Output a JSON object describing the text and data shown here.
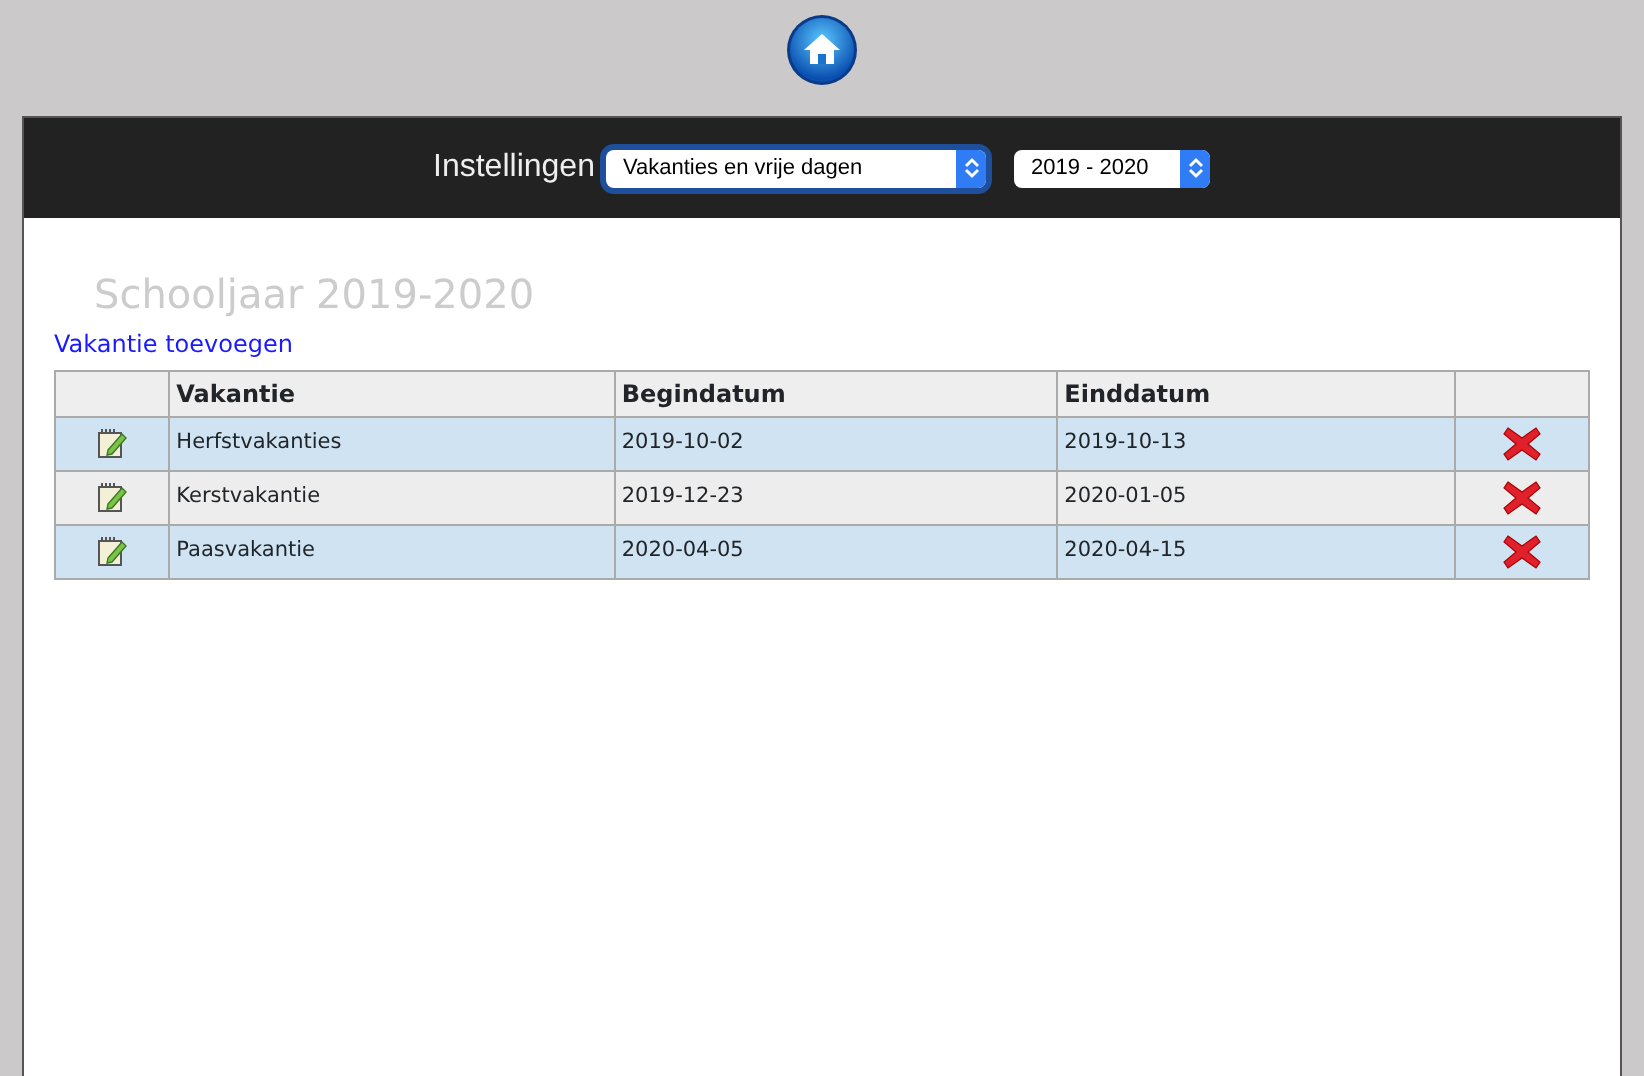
{
  "header": {
    "label": "Instellingen",
    "selects": [
      {
        "value": "Vakanties en vrije dagen",
        "focused": true
      },
      {
        "value": "2019 - 2020",
        "focused": false
      }
    ]
  },
  "title": "Schooljaar 2019-2020",
  "add_link": "Vakantie toevoegen",
  "table": {
    "columns": [
      "Vakantie",
      "Begindatum",
      "Einddatum"
    ],
    "rows": [
      {
        "name": "Herfstvakanties",
        "begin": "2019-10-02",
        "end": "2019-10-13"
      },
      {
        "name": "Kerstvakantie",
        "begin": "2019-12-23",
        "end": "2020-01-05"
      },
      {
        "name": "Paasvakantie",
        "begin": "2020-04-05",
        "end": "2020-04-15"
      }
    ]
  }
}
